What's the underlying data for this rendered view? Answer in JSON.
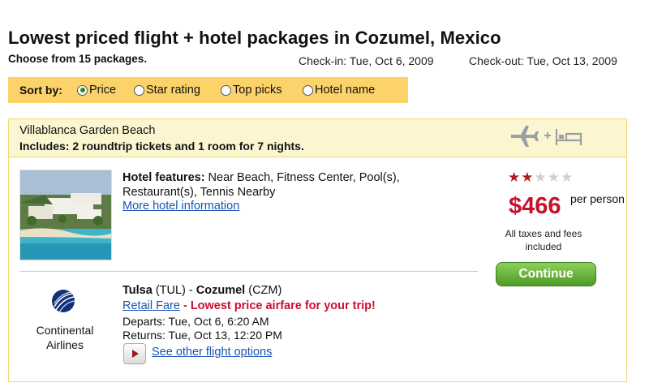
{
  "page": {
    "title": "Lowest priced flight + hotel packages in Cozumel, Mexico",
    "subtitle": "Choose from 15 packages.",
    "checkin": "Check-in: Tue, Oct 6, 2009",
    "checkout": "Check-out: Tue, Oct 13, 2009"
  },
  "sort": {
    "label": "Sort by:",
    "selected": "Price",
    "options": [
      "Price",
      "Star rating",
      "Top picks",
      "Hotel name"
    ]
  },
  "package": {
    "hotel_name": "Villablanca Garden Beach",
    "includes_prefix": "Includes: 2 roundtrip tickets and ",
    "includes_rooms": "1",
    "includes_suffix": " room for 7 nights.",
    "features_label": "Hotel features:",
    "features_text": " Near Beach, Fitness Center, Pool(s), Restaurant(s), Tennis Nearby",
    "more_info_link": "More hotel information",
    "star_rating": 2,
    "star_max": 5,
    "price": "$466",
    "per_person": "per person",
    "taxes_note": "All taxes and fees included",
    "continue_label": "Continue",
    "icons": [
      "airplane-icon",
      "plus-icon",
      "bed-icon"
    ]
  },
  "flight": {
    "airline": "Continental Airlines",
    "origin_city": "Tulsa",
    "origin_code": "(TUL)",
    "separator": " - ",
    "dest_city": "Cozumel",
    "dest_code": "(CZM)",
    "fare_link": "Retail Fare",
    "fare_dash": " - ",
    "fare_note": "Lowest price airfare for your trip!",
    "departs": "Departs: Tue, Oct 6, 6:20 AM",
    "returns": "Returns: Tue, Oct 13, 12:20 PM",
    "other_options_link": "See other flight options"
  },
  "colors": {
    "sort_bar": "#fcd36b",
    "card_header": "#fcf6d0",
    "price_red": "#c8102e",
    "link_blue": "#1a52b5",
    "continue_green": "#5aa82e"
  }
}
